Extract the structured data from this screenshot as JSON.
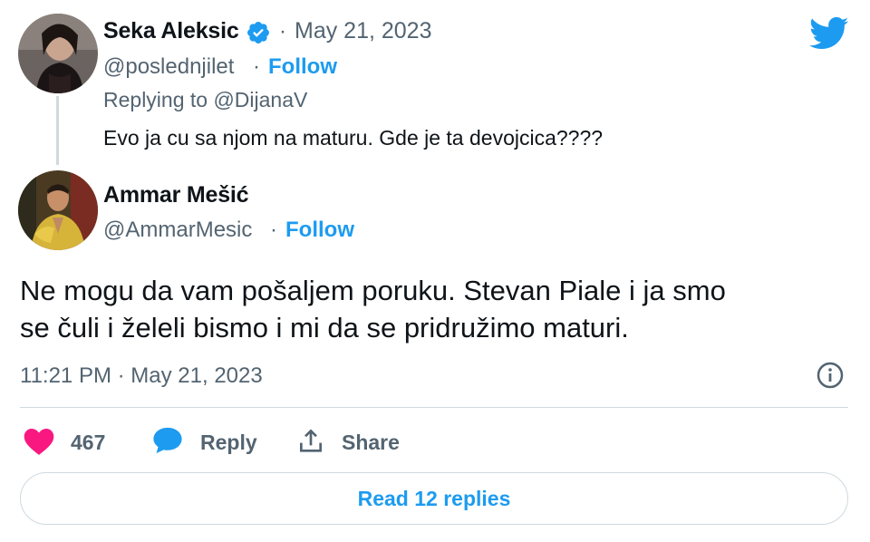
{
  "brand": {
    "logo_icon": "twitter-bird-icon",
    "color": "#1d9bf0"
  },
  "parent_tweet": {
    "author_name": "Seka Aleksic",
    "verified_icon": "verified-badge-icon",
    "separator": "·",
    "date": "May 21, 2023",
    "handle": "@poslednjilet",
    "handle_separator": "·",
    "follow_label": "Follow",
    "replying_to": "Replying to @DijanaV",
    "text": "Evo ja cu sa njom na maturu. Gde je ta devojcica????"
  },
  "main_tweet": {
    "author_name": "Ammar Mešić",
    "handle": "@AmmarMesic",
    "handle_separator": "·",
    "follow_label": "Follow",
    "text_line1": "Ne mogu da vam pošaljem poruku. Stevan Piale i ja smo",
    "text_line2": "se čuli i želeli bismo i mi da se pridružimo maturi.",
    "timestamp": "11:21 PM · May 21, 2023",
    "info_icon": "info-icon"
  },
  "actions": {
    "like_icon": "heart-icon",
    "like_count": "467",
    "reply_icon": "reply-bubble-icon",
    "reply_label": "Reply",
    "share_icon": "share-icon",
    "share_label": "Share"
  },
  "read_replies_label": "Read 12 replies",
  "colors": {
    "accent": "#1d9bf0",
    "like": "#f91880",
    "text_primary": "#0f1419",
    "text_secondary": "#536471",
    "border": "#cfd9de"
  }
}
